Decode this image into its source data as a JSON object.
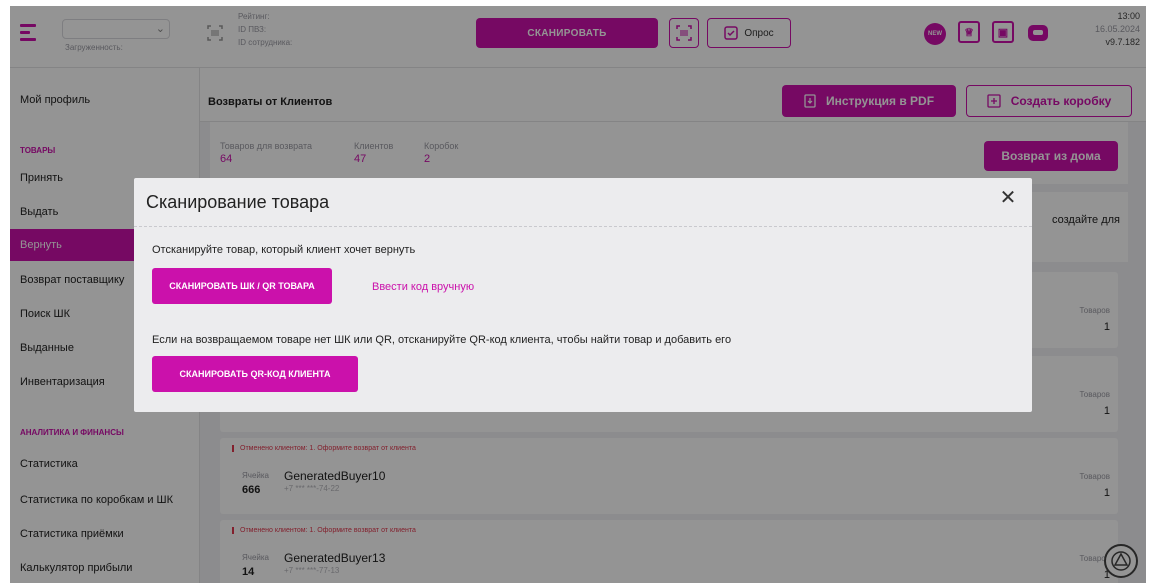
{
  "topbar": {
    "load_label": "Загруженность:",
    "rating_lines": [
      "Рейтинг:",
      "ID ПВЗ:",
      "ID сотрудника:"
    ],
    "scan_label": "СКАНИРОВАТЬ",
    "survey_label": "Опрос",
    "new_badge": "NEW",
    "time": "13:00",
    "date": "16.05.2024",
    "version": "v9.7.182"
  },
  "sidebar": {
    "profile": "Мой профиль",
    "section_goods": "ТОВАРЫ",
    "items_goods": [
      "Принять",
      "Выдать",
      "Вернуть",
      "Возврат поставщику",
      "Поиск ШК",
      "Выданные",
      "Инвентаризация"
    ],
    "section_analytics": "АНАЛИТИКА И ФИНАНСЫ",
    "items_analytics": [
      "Статистика",
      "Статистика по коробкам и ШК",
      "Статистика приёмки",
      "Калькулятор прибыли"
    ]
  },
  "main": {
    "title": "Возвраты от Клиентов",
    "pdf_label": "Инструкция в PDF",
    "box_label": "Создать коробку",
    "stats": [
      {
        "label": "Товаров для возврата",
        "value": "64"
      },
      {
        "label": "Клиентов",
        "value": "47"
      },
      {
        "label": "Коробок",
        "value": "2"
      }
    ],
    "home_return_label": "Возврат из дома",
    "hint_tail": "создайте для",
    "goods_label": "Товаров",
    "cards": [
      {
        "note": "",
        "cell_label": "",
        "cell": "",
        "name": "",
        "phone": "",
        "goods": "1"
      },
      {
        "note": "",
        "cell_label": "",
        "cell": "",
        "name": "",
        "phone": "",
        "goods": "1"
      },
      {
        "note": "Отменено клиентом: 1. Оформите возврат от клиента",
        "cell_label": "Ячейка",
        "cell": "666",
        "name": "GeneratedBuyer10",
        "phone": "+7 *** ***-74-22",
        "goods": "1"
      },
      {
        "note": "Отменено клиентом: 1. Оформите возврат от клиента",
        "cell_label": "Ячейка",
        "cell": "14",
        "name": "GeneratedBuyer13",
        "phone": "+7 *** ***-77-13",
        "goods": "1"
      }
    ]
  },
  "modal": {
    "title": "Сканирование товара",
    "text1": "Отсканируйте товар, который клиент хочет вернуть",
    "btn_scan_item": "СКАНИРОВАТЬ ШК / QR ТОВАРА",
    "link_manual": "Ввести код вручную",
    "text2": "Если на возвращаемом товаре нет ШК или QR, отсканируйте QR-код клиента, чтобы найти товар и добавить его",
    "btn_scan_client": "СКАНИРОВАТЬ QR-КОД КЛИЕНТА"
  },
  "colors": {
    "accent": "#cb11ab",
    "alert": "#e0384e",
    "background": "#f2f2f4"
  }
}
